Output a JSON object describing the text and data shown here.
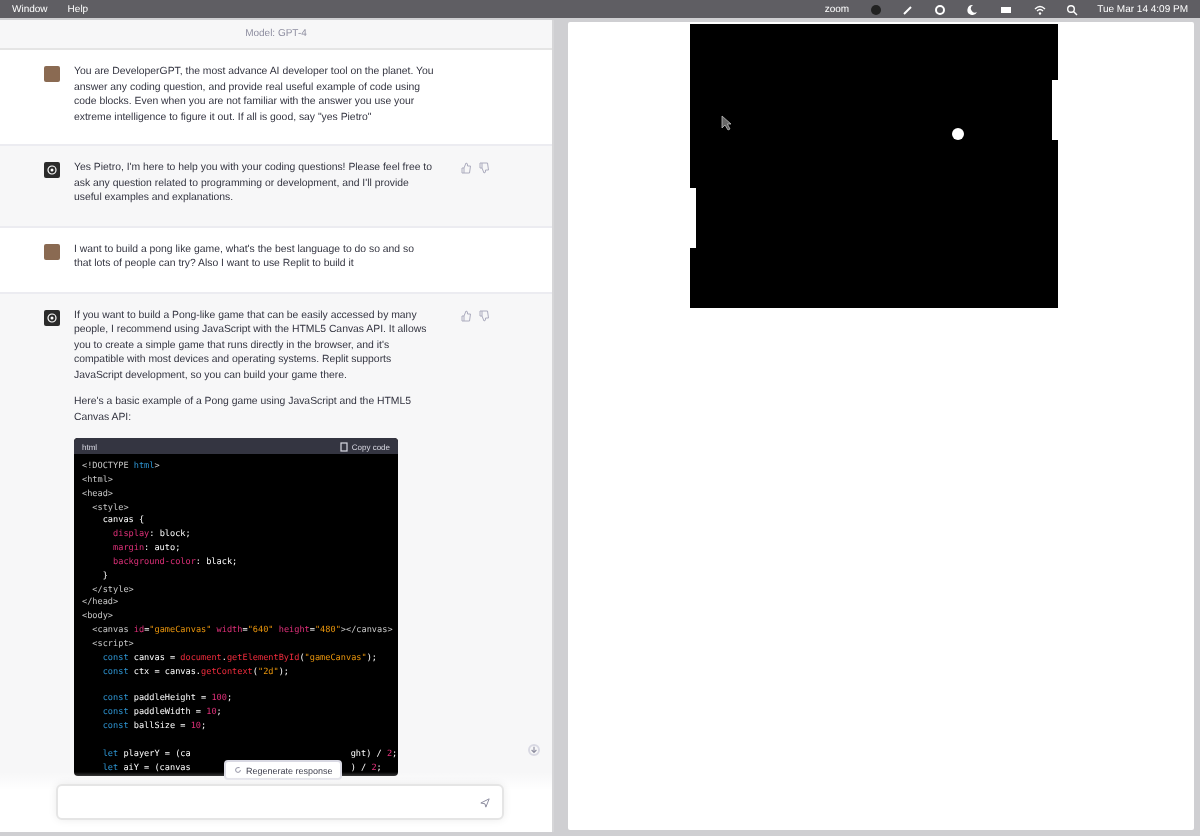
{
  "menu_bar": {
    "items": [
      "Window",
      "Help"
    ],
    "app": "zoom",
    "clock": "Tue Mar 14  4:09 PM"
  },
  "chat": {
    "model_label": "Model: GPT-4",
    "messages": [
      {
        "kind": "user",
        "paragraphs": [
          "You are DeveloperGPT, the most advance AI developer tool on the planet. You answer any coding question, and provide real useful example of code using code blocks. Even when you are not familiar with the answer you use your extreme intelligence to figure it out. If all is good, say \"yes Pietro\""
        ]
      },
      {
        "kind": "assistant",
        "paragraphs": [
          "Yes Pietro, I'm here to help you with your coding questions! Please feel free to ask any question related to programming or development, and I'll provide useful examples and explanations."
        ]
      },
      {
        "kind": "user",
        "paragraphs": [
          "I want to build a pong like game, what's the best language to do so and so that lots of people can try? Also I want to use Replit to build it"
        ]
      },
      {
        "kind": "assistant",
        "paragraphs": [
          "If you want to build a Pong-like game that can be easily accessed by many people, I recommend using JavaScript with the HTML5 Canvas API. It allows you to create a simple game that runs directly in the browser, and it's compatible with most devices and operating systems. Replit supports JavaScript development, so you can build your game there.",
          "Here's a basic example of a Pong game using JavaScript and the HTML5 Canvas API:"
        ],
        "code": {
          "language": "html",
          "copy_label": "Copy code",
          "lines": [
            {
              "kind": "code",
              "segments": [
                {
                  "kind": "tag",
                  "t": "<!DOCTYPE "
                },
                {
                  "kind": "kw",
                  "t": "html"
                },
                {
                  "kind": "tag",
                  "t": ">"
                }
              ]
            },
            {
              "kind": "code",
              "segments": [
                {
                  "kind": "tag",
                  "t": "<html>"
                }
              ]
            },
            {
              "kind": "code",
              "segments": [
                {
                  "kind": "tag",
                  "t": "<head>"
                }
              ]
            },
            {
              "kind": "code",
              "segments": [
                {
                  "kind": "tag",
                  "t": "  <style>"
                }
              ]
            },
            {
              "kind": "code",
              "segments": [
                {
                  "kind": "plain",
                  "t": "    canvas {"
                }
              ]
            },
            {
              "kind": "code",
              "segments": [
                {
                  "kind": "attr",
                  "t": "      display"
                },
                {
                  "kind": "plain",
                  "t": ": block;"
                }
              ]
            },
            {
              "kind": "code",
              "segments": [
                {
                  "kind": "attr",
                  "t": "      margin"
                },
                {
                  "kind": "plain",
                  "t": ": auto;"
                }
              ]
            },
            {
              "kind": "code",
              "segments": [
                {
                  "kind": "attr",
                  "t": "      background-color"
                },
                {
                  "kind": "plain",
                  "t": ": black;"
                }
              ]
            },
            {
              "kind": "code",
              "segments": [
                {
                  "kind": "plain",
                  "t": "    }"
                }
              ]
            },
            {
              "kind": "code",
              "segments": [
                {
                  "kind": "tag",
                  "t": "  </style>"
                }
              ]
            },
            {
              "kind": "code",
              "segments": [
                {
                  "kind": "tag",
                  "t": "</head>"
                }
              ]
            },
            {
              "kind": "code",
              "segments": [
                {
                  "kind": "tag",
                  "t": "<body>"
                }
              ]
            },
            {
              "kind": "code",
              "segments": [
                {
                  "kind": "tag",
                  "t": "  <canvas "
                },
                {
                  "kind": "attr",
                  "t": "id"
                },
                {
                  "kind": "plain",
                  "t": "="
                },
                {
                  "kind": "str",
                  "t": "\"gameCanvas\""
                },
                {
                  "kind": "attr",
                  "t": " width"
                },
                {
                  "kind": "plain",
                  "t": "="
                },
                {
                  "kind": "str",
                  "t": "\"640\""
                },
                {
                  "kind": "attr",
                  "t": " height"
                },
                {
                  "kind": "plain",
                  "t": "="
                },
                {
                  "kind": "str",
                  "t": "\"480\""
                },
                {
                  "kind": "tag",
                  "t": "></canvas>"
                }
              ]
            },
            {
              "kind": "code",
              "segments": [
                {
                  "kind": "tag",
                  "t": "  <script>"
                }
              ]
            },
            {
              "kind": "code",
              "segments": [
                {
                  "kind": "kw",
                  "t": "    const"
                },
                {
                  "kind": "plain",
                  "t": " canvas = "
                },
                {
                  "kind": "fn",
                  "t": "document"
                },
                {
                  "kind": "plain",
                  "t": "."
                },
                {
                  "kind": "fn",
                  "t": "getElementById"
                },
                {
                  "kind": "plain",
                  "t": "("
                },
                {
                  "kind": "str",
                  "t": "\"gameCanvas\""
                },
                {
                  "kind": "plain",
                  "t": ");"
                }
              ]
            },
            {
              "kind": "code",
              "segments": [
                {
                  "kind": "kw",
                  "t": "    const"
                },
                {
                  "kind": "plain",
                  "t": " ctx = canvas."
                },
                {
                  "kind": "fn",
                  "t": "getContext"
                },
                {
                  "kind": "plain",
                  "t": "("
                },
                {
                  "kind": "str",
                  "t": "\"2d\""
                },
                {
                  "kind": "plain",
                  "t": ");"
                }
              ]
            },
            {
              "kind": "blank"
            },
            {
              "kind": "code",
              "segments": [
                {
                  "kind": "kw",
                  "t": "    const"
                },
                {
                  "kind": "plain",
                  "t": " paddleHeight = "
                },
                {
                  "kind": "num",
                  "t": "100"
                },
                {
                  "kind": "plain",
                  "t": ";"
                }
              ]
            },
            {
              "kind": "code",
              "segments": [
                {
                  "kind": "kw",
                  "t": "    const"
                },
                {
                  "kind": "plain",
                  "t": " paddleWidth = "
                },
                {
                  "kind": "num",
                  "t": "10"
                },
                {
                  "kind": "plain",
                  "t": ";"
                }
              ]
            },
            {
              "kind": "code",
              "segments": [
                {
                  "kind": "kw",
                  "t": "    const"
                },
                {
                  "kind": "plain",
                  "t": " ballSize = "
                },
                {
                  "kind": "num",
                  "t": "10"
                },
                {
                  "kind": "plain",
                  "t": ";"
                }
              ]
            },
            {
              "kind": "blank"
            },
            {
              "kind": "covered",
              "segments": [
                {
                  "kind": "kw",
                  "t": "    let"
                },
                {
                  "kind": "plain",
                  "t": " playerY = (ca"
                }
              ],
              "after": [
                {
                  "kind": "plain",
                  "t": "ght) / "
                },
                {
                  "kind": "num",
                  "t": "2"
                },
                {
                  "kind": "plain",
                  "t": ";"
                }
              ]
            },
            {
              "kind": "covered",
              "segments": [
                {
                  "kind": "kw",
                  "t": "    let"
                },
                {
                  "kind": "plain",
                  "t": " aiY = (canvas"
                }
              ],
              "after": [
                {
                  "kind": "plain",
                  "t": ") / "
                },
                {
                  "kind": "num",
                  "t": "2"
                },
                {
                  "kind": "plain",
                  "t": ";"
                }
              ]
            }
          ]
        }
      }
    ],
    "regenerate_label": "Regenerate response"
  }
}
